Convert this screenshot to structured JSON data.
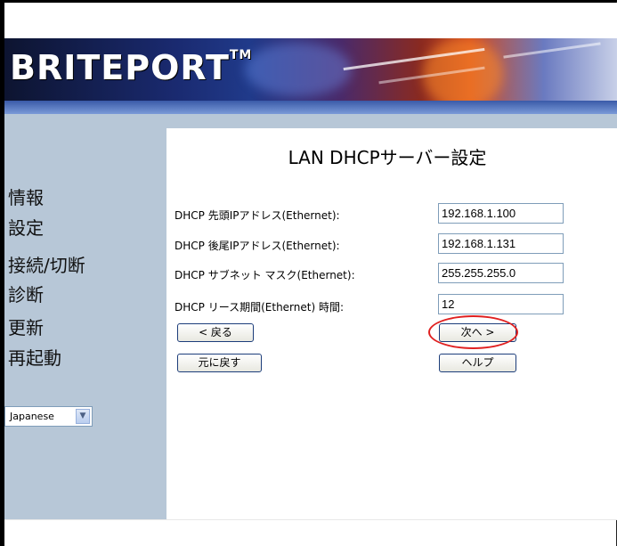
{
  "header": {
    "logo_text": "BRITEPORT",
    "logo_mark": "TM"
  },
  "sidebar": {
    "items": [
      {
        "label": "情報"
      },
      {
        "label": "設定"
      },
      {
        "label": "接続/切断"
      },
      {
        "label": "診断"
      },
      {
        "label": "更新"
      },
      {
        "label": "再起動"
      }
    ],
    "language_select": {
      "value": "Japanese"
    }
  },
  "main": {
    "title": "LAN DHCPサーバー設定",
    "rows": [
      {
        "label": "DHCP 先頭IPアドレス(Ethernet):",
        "value": "192.168.1.100"
      },
      {
        "label": "DHCP 後尾IPアドレス(Ethernet):",
        "value": "192.168.1.131"
      },
      {
        "label": "DHCP サブネット マスク(Ethernet):",
        "value": "255.255.255.0"
      },
      {
        "label": "DHCP リース期間(Ethernet) 時間:",
        "value": "12"
      }
    ],
    "buttons": {
      "back": "< 戻る",
      "next": "次へ >",
      "revert": "元に戻す",
      "help": "ヘルプ"
    }
  },
  "colors": {
    "sidebar_bg": "#b7c7d7",
    "highlight": "#e02020"
  }
}
